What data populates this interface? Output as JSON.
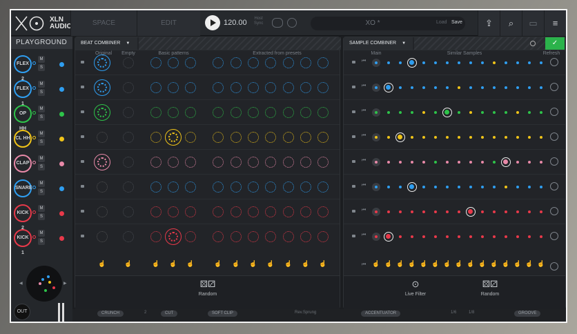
{
  "app": {
    "brand_line1": "XLN",
    "brand_line2": "AUDIO"
  },
  "topbar": {
    "tab_space": "SPACE",
    "tab_edit": "EDIT",
    "tempo": "120.00",
    "host_sync_1": "Host",
    "host_sync_2": "Sync",
    "preset_name": "XO *",
    "load": "Load",
    "save": "Save"
  },
  "rail": {
    "title": "PLAYGROUND",
    "out": "OUT",
    "m": "M",
    "s": "S",
    "tracks": [
      {
        "name": "FLEX 2",
        "color": "#2f9ef0"
      },
      {
        "name": "FLEX 1",
        "color": "#2f9ef0"
      },
      {
        "name": "OP HH",
        "color": "#2ec44a"
      },
      {
        "name": "CL HH",
        "color": "#f0c419"
      },
      {
        "name": "CLAP",
        "color": "#e889a8"
      },
      {
        "name": "SNARE",
        "color": "#2f9ef0"
      },
      {
        "name": "KICK 2",
        "color": "#e8394a"
      },
      {
        "name": "KICK 1",
        "color": "#e8394a"
      }
    ]
  },
  "beat": {
    "title": "BEAT COMBINER",
    "col_original": "Original",
    "col_empty": "Empty",
    "col_basic": "Basic patterns",
    "col_extracted": "Extracted from presets",
    "random": "Random"
  },
  "sample": {
    "title": "SAMPLE COMBINER",
    "col_main": "Main",
    "col_similar": "Similar Samples",
    "col_refresh": "Refresh",
    "live_filter": "Live Filter",
    "random": "Random",
    "selected_index": [
      2,
      0,
      5,
      1,
      10,
      2,
      7,
      0
    ]
  },
  "bottom": {
    "crunch": "CRUNCH",
    "cut": "CUT",
    "soft_clip": "SOFT CLIP",
    "groove_name": "Rev.Sprung",
    "accentuator": "ACCENTUATOR",
    "div1": "1/6",
    "div2": "1/8",
    "groove": "GROOVE",
    "n2": "2"
  }
}
